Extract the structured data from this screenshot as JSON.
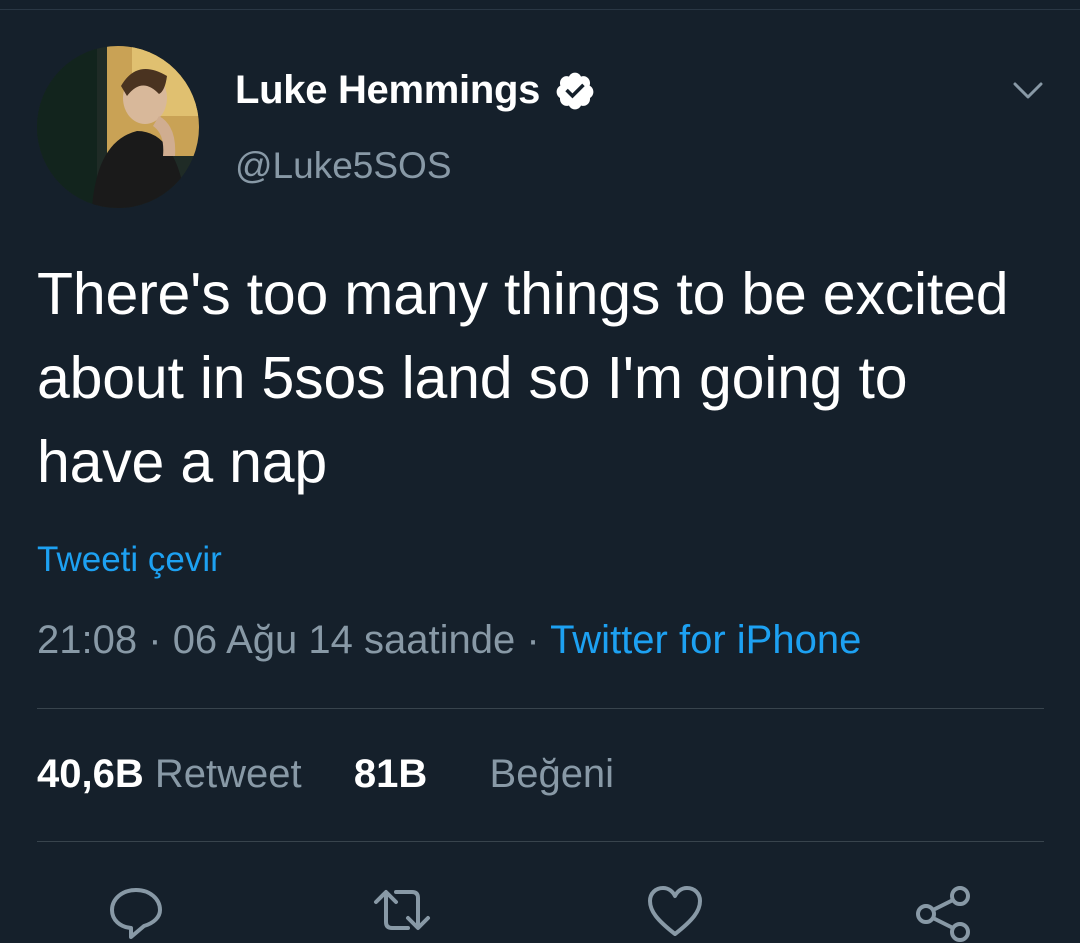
{
  "colors": {
    "background": "#15202b",
    "text_primary": "#ffffff",
    "text_secondary": "#8899a6",
    "link": "#1da1f2",
    "divider": "#38444d"
  },
  "author": {
    "display_name": "Luke Hemmings",
    "handle": "@Luke5SOS",
    "verified": true,
    "avatar_icon": "profile-photo"
  },
  "tweet": {
    "text": "There's too many things to be excited about in 5sos land so I'm going to have a nap",
    "translate_label": "Tweeti çevir",
    "time": "21:08",
    "separator": "·",
    "date": "06 Ağu 14 saatinde",
    "source": "Twitter for iPhone"
  },
  "stats": {
    "retweet_count": "40,6B",
    "retweet_label": "Retweet",
    "like_count": "81B",
    "like_label": "Beğeni"
  },
  "actions": {
    "reply_icon": "reply-icon",
    "retweet_icon": "retweet-icon",
    "like_icon": "heart-icon",
    "share_icon": "share-icon"
  },
  "menu_icon": "chevron-down-icon"
}
